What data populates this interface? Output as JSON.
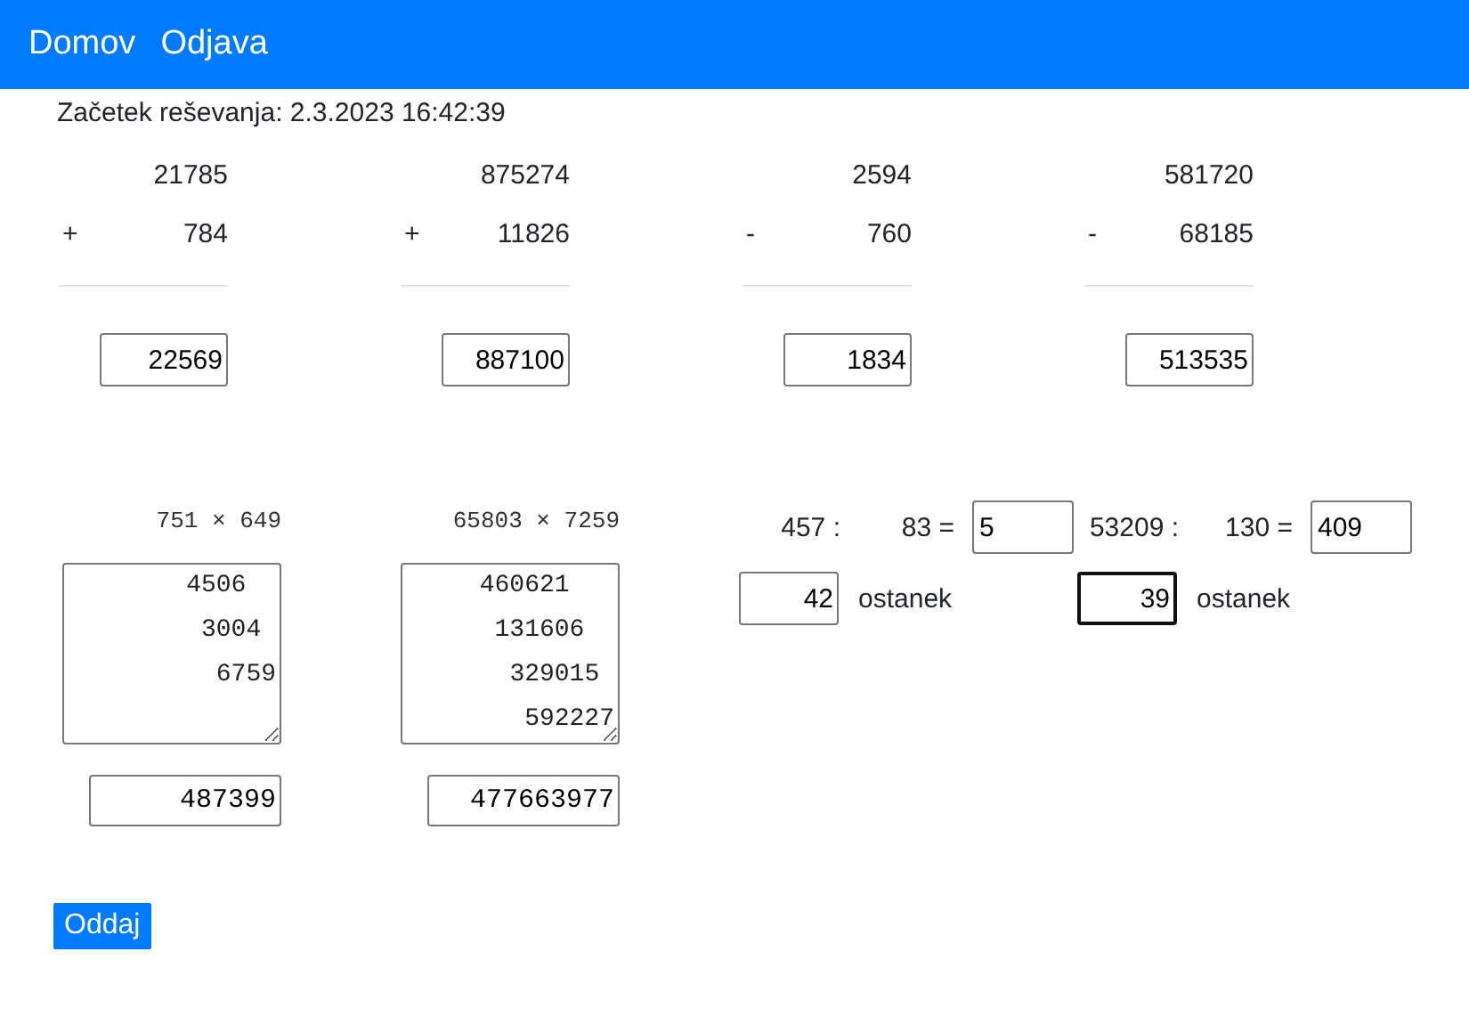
{
  "nav": [
    "Domov",
    "Odjava"
  ],
  "start_label": "Začetek reševanja: 2.3.2023 16:42:39",
  "additions": [
    {
      "first": "21785",
      "operator": "+",
      "second": "784",
      "answer": "22569"
    },
    {
      "first": "875274",
      "operator": "+",
      "second": "11826",
      "answer": "887100"
    },
    {
      "first": "2594",
      "operator": "-",
      "second": "760",
      "answer": "1834"
    },
    {
      "first": "581720",
      "operator": "-",
      "second": "68185",
      "answer": "513535"
    }
  ],
  "multiplications": [
    {
      "expression": "751 × 649",
      "work": [
        "4506",
        "3004",
        "6759"
      ],
      "answer": "487399"
    },
    {
      "expression": "65803 × 7259",
      "work": [
        "460621",
        "131606",
        "329015",
        "592227"
      ],
      "answer": "477663977"
    }
  ],
  "divisions": [
    {
      "dividend": "457 :",
      "divisor": "83 =",
      "quotient": "5",
      "remainder": "42",
      "remainder_label": "ostanek",
      "remainder_focused": false
    },
    {
      "dividend": "53209 :",
      "divisor": "130 =",
      "quotient": "409",
      "remainder": "39",
      "remainder_label": "ostanek",
      "remainder_focused": true
    }
  ],
  "submit": "Oddaj"
}
